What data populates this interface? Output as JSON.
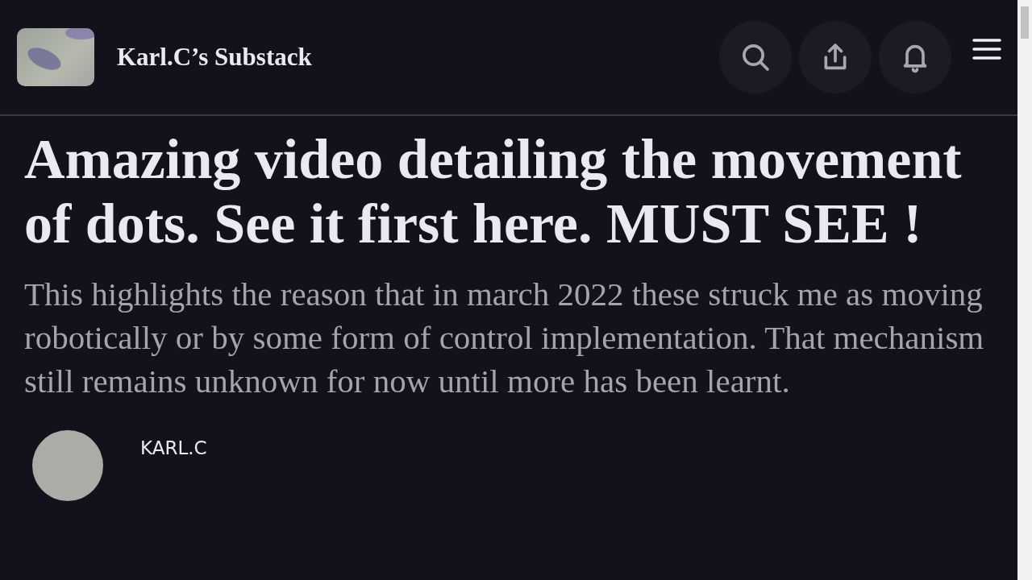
{
  "header": {
    "publication": "Karl.C’s Substack"
  },
  "post": {
    "title": "Amazing video detailing the movement of dots. See it first here. MUST SEE !",
    "subtitle": "This highlights the reason that in march 2022 these struck me as moving robotically or by some form of control implementation. That mechanism still remains unknown for now until more has been learnt.",
    "author": "KARL.C"
  }
}
